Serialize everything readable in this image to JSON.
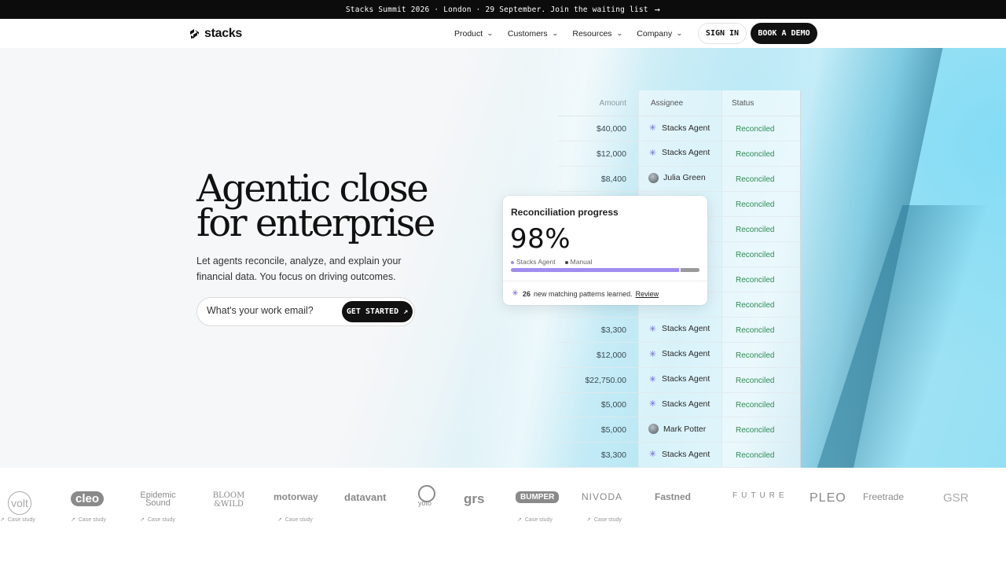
{
  "announcement": {
    "text": "Stacks Summit 2026 · London · 29 September. Join the waiting list",
    "arrow": "→"
  },
  "nav": {
    "logo_text": "stacks",
    "menu": [
      {
        "label": "Product"
      },
      {
        "label": "Customers"
      },
      {
        "label": "Resources"
      },
      {
        "label": "Company"
      }
    ],
    "sign_in": "SIGN IN",
    "book_demo": "BOOK A DEMO"
  },
  "hero": {
    "headline_line1": "Agentic close",
    "headline_line2": "for enterprise",
    "subtext": "Let agents reconcile, analyze, and explain your financial data. You focus on driving outcomes.",
    "email_placeholder": "What's your work email?",
    "cta": "GET STARTED",
    "cta_icon": "↗"
  },
  "table": {
    "headers": {
      "amount": "Amount",
      "assignee": "Assignee",
      "status": "Status"
    },
    "rows": [
      {
        "amount": "$40,000",
        "assignee": "Stacks Agent",
        "type": "agent",
        "status": "Reconciled"
      },
      {
        "amount": "$12,000",
        "assignee": "Stacks Agent",
        "type": "agent",
        "status": "Reconciled"
      },
      {
        "amount": "$8,400",
        "assignee": "Julia Green",
        "type": "person",
        "status": "Reconciled"
      },
      {
        "amount": "",
        "assignee": "",
        "type": "hidden",
        "status": "Reconciled"
      },
      {
        "amount": "",
        "assignee": "",
        "type": "hidden",
        "status": "Reconciled"
      },
      {
        "amount": "",
        "assignee": "",
        "type": "hidden",
        "status": "Reconciled"
      },
      {
        "amount": "",
        "assignee": "",
        "type": "hidden",
        "status": "Reconciled"
      },
      {
        "amount": "",
        "assignee": "",
        "type": "hidden",
        "status": "Reconciled"
      },
      {
        "amount": "$3,300",
        "assignee": "Stacks Agent",
        "type": "agent",
        "status": "Reconciled"
      },
      {
        "amount": "$12,000",
        "assignee": "Stacks Agent",
        "type": "agent",
        "status": "Reconciled"
      },
      {
        "amount": "$22,750.00",
        "assignee": "Stacks Agent",
        "type": "agent",
        "status": "Reconciled"
      },
      {
        "amount": "$5,000",
        "assignee": "Stacks Agent",
        "type": "agent",
        "status": "Reconciled"
      },
      {
        "amount": "$5,000",
        "assignee": "Mark Potter",
        "type": "person",
        "status": "Reconciled"
      },
      {
        "amount": "$3,300",
        "assignee": "Stacks Agent",
        "type": "agent",
        "status": "Reconciled"
      }
    ],
    "status_color": "#2f8a55"
  },
  "progress_card": {
    "title": "Reconciliation progress",
    "percent": "98%",
    "legend_agent": "Stacks Agent",
    "legend_manual": "Manual",
    "agent_share": 0.89,
    "manual_share": 0.1,
    "agent_color": "#a08cf0",
    "manual_color": "#9a9a9a",
    "footer_count": "26",
    "footer_text": "new matching patterns learned.",
    "footer_link": "Review"
  },
  "logos": [
    {
      "name": "volt",
      "text": "volt",
      "case_study": "Case study"
    },
    {
      "name": "cleo",
      "text": "cleo",
      "case_study": "Case study"
    },
    {
      "name": "epidemic-sound",
      "text": "Epidemic Sound",
      "case_study": "Case study"
    },
    {
      "name": "bloom-wild",
      "text": "BLOOM &WILD",
      "case_study": ""
    },
    {
      "name": "motorway",
      "text": "motorway",
      "case_study": "Case study"
    },
    {
      "name": "datavant",
      "text": "datavant",
      "case_study": ""
    },
    {
      "name": "yoto",
      "text": "yoto",
      "case_study": ""
    },
    {
      "name": "grs",
      "text": "grs",
      "case_study": ""
    },
    {
      "name": "bumper",
      "text": "BUMPER",
      "case_study": "Case study"
    },
    {
      "name": "nivoda",
      "text": "NIVODA",
      "case_study": "Case study"
    },
    {
      "name": "fastned",
      "text": "Fastned",
      "case_study": ""
    },
    {
      "name": "future",
      "text": "FUTURE",
      "case_study": ""
    },
    {
      "name": "pleo",
      "text": "PLEO",
      "case_study": ""
    },
    {
      "name": "freetrade",
      "text": "Freetrade",
      "case_study": ""
    },
    {
      "name": "gsr",
      "text": "GSR",
      "case_study": ""
    }
  ]
}
